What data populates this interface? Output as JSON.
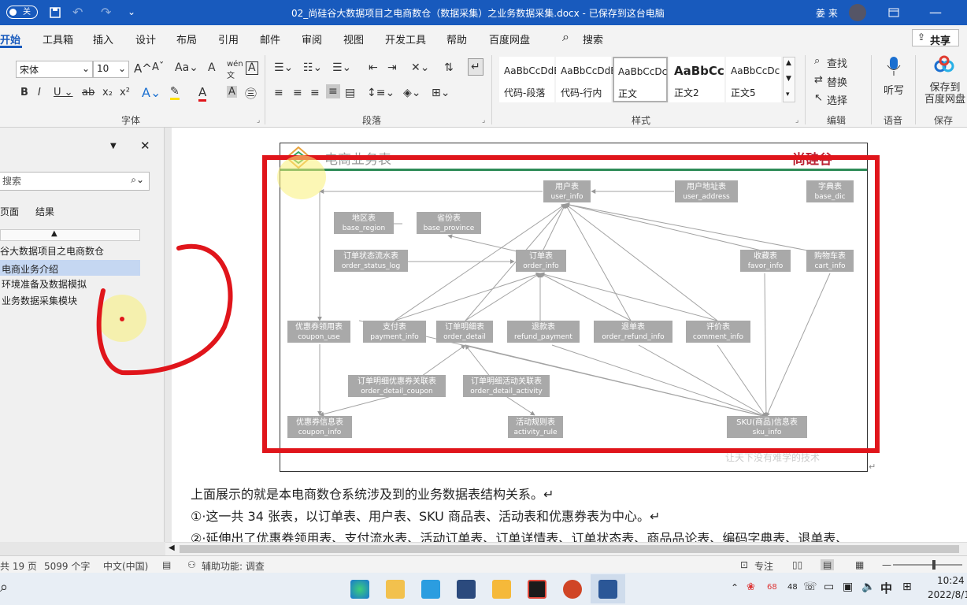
{
  "titlebar": {
    "autosave_state": "关",
    "doc_title": "02_尚硅谷大数据项目之电商数仓（数据采集）之业务数据采集.docx  -  已保存到这台电脑",
    "user": "姜 来"
  },
  "menu": {
    "tabs": [
      "开始",
      "工具箱",
      "插入",
      "设计",
      "布局",
      "引用",
      "邮件",
      "审阅",
      "视图",
      "开发工具",
      "帮助",
      "百度网盘"
    ],
    "search_label": "搜索",
    "share_label": "共享"
  },
  "ribbon": {
    "font_name": "宋体",
    "font_size": "10",
    "font_group": "字体",
    "para_group": "段落",
    "style_group": "样式",
    "edit_group": "编辑",
    "voice_group": "语音",
    "save_group": "保存",
    "styles": [
      {
        "preview": "AaBbCcDdE",
        "name": "代码-段落"
      },
      {
        "preview": "AaBbCcDdE",
        "name": "代码-行内"
      },
      {
        "preview": "AaBbCcDc",
        "name": "正文"
      },
      {
        "preview": "AaBbCc",
        "name": "正文2"
      },
      {
        "preview": "AaBbCcDc",
        "name": "正文5"
      }
    ],
    "find": "查找",
    "replace": "替换",
    "select": "选择",
    "dictate": "听写",
    "save_baidu": "保存到\n百度网盘"
  },
  "nav": {
    "search_placeholder": "搜索",
    "tab_pages": "页面",
    "tab_results": "结果",
    "items": [
      "谷大数据项目之电商数仓",
      "电商业务介绍",
      "环境准备及数据模拟",
      "业务数据采集模块"
    ]
  },
  "figure": {
    "title": "电商业务表",
    "logo": "尚硅谷",
    "watermark": "让天下没有难学的技术",
    "nodes": [
      {
        "cn": "用户表",
        "en": "user_info"
      },
      {
        "cn": "用户地址表",
        "en": "user_address"
      },
      {
        "cn": "字典表",
        "en": "base_dic"
      },
      {
        "cn": "地区表",
        "en": "base_region"
      },
      {
        "cn": "省份表",
        "en": "base_province"
      },
      {
        "cn": "订单状态流水表",
        "en": "order_status_log"
      },
      {
        "cn": "订单表",
        "en": "order_info"
      },
      {
        "cn": "收藏表",
        "en": "favor_info"
      },
      {
        "cn": "购物车表",
        "en": "cart_info"
      },
      {
        "cn": "优惠券领用表",
        "en": "coupon_use"
      },
      {
        "cn": "支付表",
        "en": "payment_info"
      },
      {
        "cn": "订单明细表",
        "en": "order_detail"
      },
      {
        "cn": "退款表",
        "en": "refund_payment"
      },
      {
        "cn": "退单表",
        "en": "order_refund_info"
      },
      {
        "cn": "评价表",
        "en": "comment_info"
      },
      {
        "cn": "订单明细优惠券关联表",
        "en": "order_detail_coupon"
      },
      {
        "cn": "订单明细活动关联表",
        "en": "order_detail_activity"
      },
      {
        "cn": "优惠券信息表",
        "en": "coupon_info"
      },
      {
        "cn": "活动规则表",
        "en": "activity_rule"
      },
      {
        "cn": "SKU(商品)信息表",
        "en": "sku_info"
      }
    ]
  },
  "body": {
    "p1": "上面展示的就是本电商数仓系统涉及到的业务数据表结构关系。↵",
    "p2": "①·这一共 34 张表，以订单表、用户表、SKU 商品表、活动表和优惠券表为中心。↵",
    "p3": "②·延伸出了优惠券领用表、支付流水表、活动订单表、订单详情表、订单状态表、商品品论表、编码字典表、退单表、"
  },
  "status": {
    "page": "共 19 页",
    "words": "5099 个字",
    "lang": "中文(中国)",
    "access": "辅助功能: 调查",
    "focus": "专注"
  },
  "taskbar": {
    "temp": "68",
    "temp2": "48",
    "ime": "中",
    "time": "10:24",
    "date": "2022/8/1"
  },
  "colors": {
    "brand": "#185abd",
    "annotation": "#e0151b",
    "node": "#a9a9a9"
  }
}
